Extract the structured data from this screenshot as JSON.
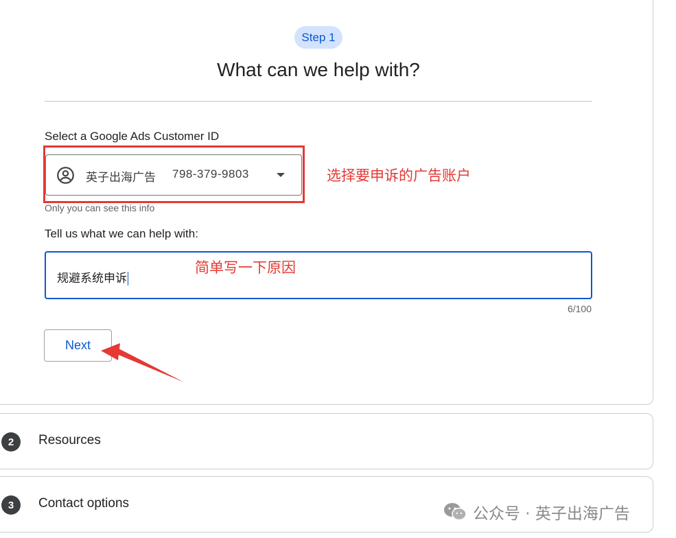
{
  "step1": {
    "chip": "Step 1",
    "title": "What can we help with?",
    "select_label": "Select a Google Ads Customer ID",
    "account": {
      "name": "英子出海广告",
      "id": "798-379-9803",
      "icon": "account-circle-icon"
    },
    "hint": "Only you can see this info",
    "help_label": "Tell us what we can help with:",
    "help_value": "规避系统申诉",
    "char_counter": "6/100",
    "next_label": "Next"
  },
  "annotations": {
    "select_note": "选择要申诉的广告账户",
    "reason_note": "简单写一下原因",
    "color": "#e53935"
  },
  "steps": [
    {
      "num": "2",
      "label": "Resources"
    },
    {
      "num": "3",
      "label": "Contact options"
    }
  ],
  "watermark": {
    "text": "公众号 · 英子出海广告",
    "icon": "wechat-icon"
  },
  "colors": {
    "accent": "#0b57d0",
    "chip_bg": "#d3e3fd",
    "annotation_red": "#e53935"
  }
}
